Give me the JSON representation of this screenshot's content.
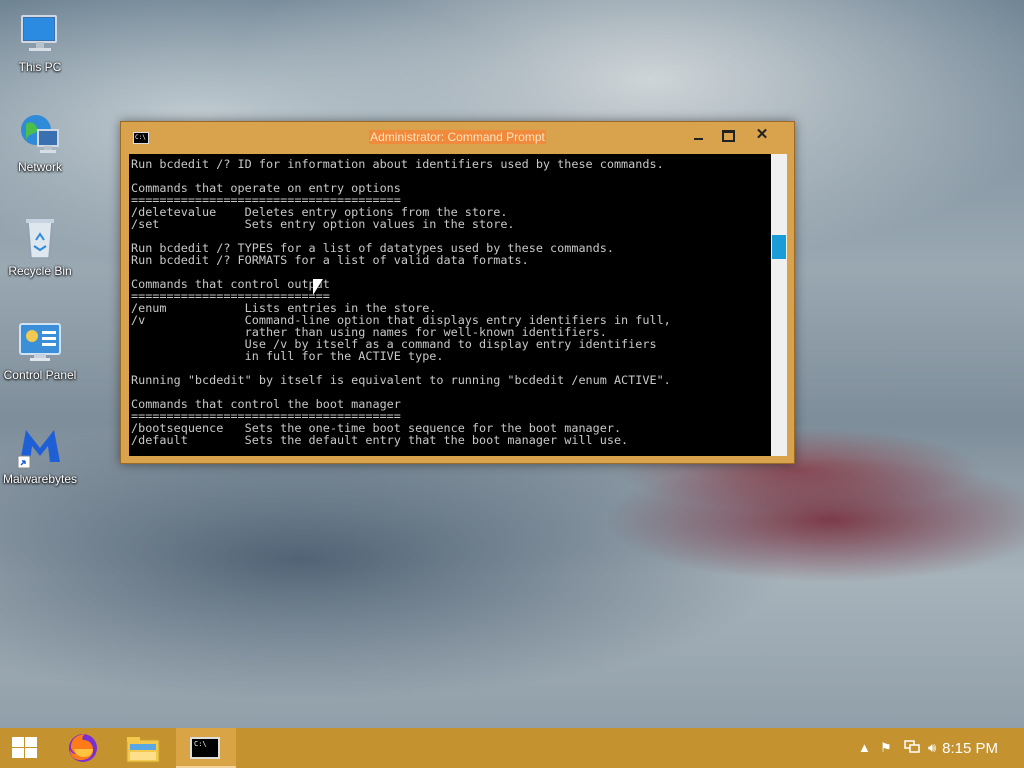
{
  "desktop": {
    "icons": [
      {
        "label": "This PC"
      },
      {
        "label": "Network"
      },
      {
        "label": "Recycle Bin"
      },
      {
        "label": "Control Panel"
      },
      {
        "label": "Malwarebytes"
      }
    ]
  },
  "window": {
    "title": "Administrator: Command Prompt",
    "minimize_label": "",
    "close_label": "✕",
    "icon_text": "C:\\",
    "console_lines": [
      "Run bcdedit /? ID for information about identifiers used by these commands.",
      "",
      "Commands that operate on entry options",
      "======================================",
      "/deletevalue    Deletes entry options from the store.",
      "/set            Sets entry option values in the store.",
      "",
      "Run bcdedit /? TYPES for a list of datatypes used by these commands.",
      "Run bcdedit /? FORMATS for a list of valid data formats.",
      "",
      "Commands that control output",
      "============================",
      "/enum           Lists entries in the store.",
      "/v              Command-line option that displays entry identifiers in full,",
      "                rather than using names for well-known identifiers.",
      "                Use /v by itself as a command to display entry identifiers",
      "                in full for the ACTIVE type.",
      "",
      "Running \"bcdedit\" by itself is equivalent to running \"bcdedit /enum ACTIVE\".",
      "",
      "Commands that control the boot manager",
      "======================================",
      "/bootsequence   Sets the one-time boot sequence for the boot manager.",
      "/default        Sets the default entry that the boot manager will use."
    ],
    "scroll_position": 0.29
  },
  "taskbar": {
    "clock": "8:15 PM",
    "apps": [
      "firefox-icon",
      "file-explorer-icon",
      "command-prompt-icon"
    ],
    "tray_icons": [
      "chevron-up-icon",
      "action-center-flag-icon",
      "network-icon",
      "volume-icon"
    ]
  },
  "colors": {
    "accent": "#c4922f",
    "window_frame": "#d9a24c",
    "console_bg": "#000000",
    "console_fg": "#c8c8c8",
    "scroll_thumb": "#1a9cd8"
  }
}
